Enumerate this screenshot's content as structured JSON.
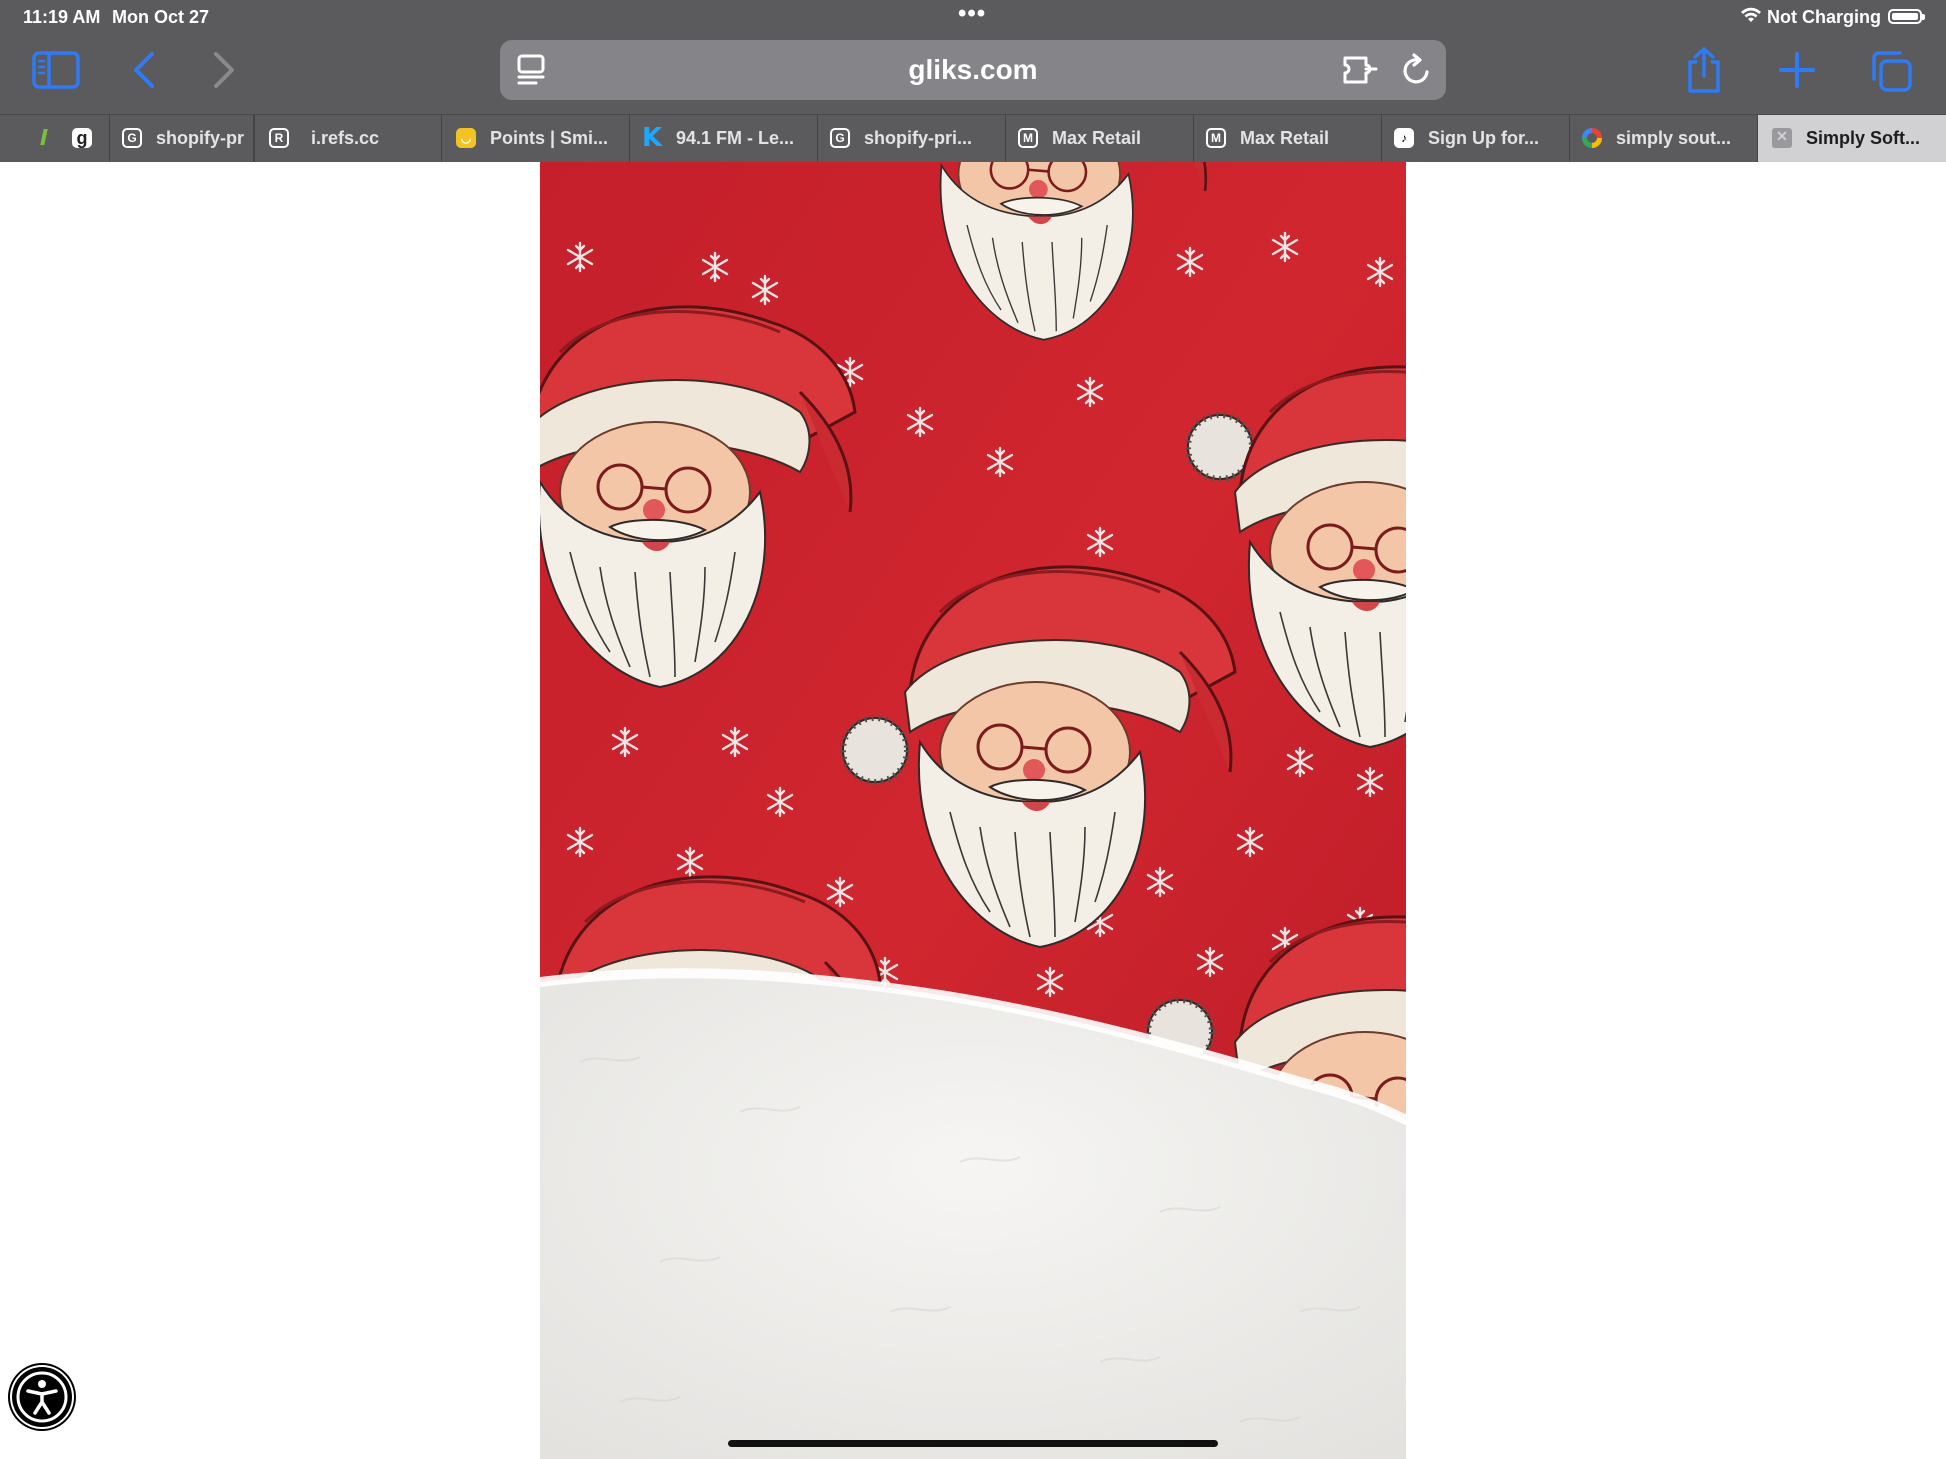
{
  "status_bar": {
    "time": "11:19 AM",
    "date": "Mon Oct 27",
    "dots": "•••",
    "battery_text": "Not Charging"
  },
  "toolbar": {
    "icons": [
      "sidebar-icon",
      "back-icon",
      "forward-icon",
      "share-icon",
      "plus-icon",
      "tabs-overview-icon"
    ]
  },
  "address_bar": {
    "url": "gliks.com",
    "icons": [
      "reader-icon",
      "extension-icon",
      "reload-icon"
    ]
  },
  "tabs": [
    {
      "label": "",
      "favicon": "g"
    },
    {
      "label": "shopify-pr",
      "favicon": "G"
    },
    {
      "label": "i.refs.cc",
      "favicon": "R"
    },
    {
      "label": "Points | Smi...",
      "favicon": "◡"
    },
    {
      "label": "94.1 FM - Le...",
      "favicon": "K"
    },
    {
      "label": "shopify-pri...",
      "favicon": "G"
    },
    {
      "label": "Max Retail",
      "favicon": "M"
    },
    {
      "label": "Max Retail",
      "favicon": "M"
    },
    {
      "label": "Sign Up for...",
      "favicon": "♪"
    },
    {
      "label": "simply sout...",
      "favicon": ""
    },
    {
      "label": "Simply Soft...",
      "favicon": "✕",
      "active": true
    }
  ],
  "colors": {
    "chrome": "#5b5b5e",
    "address_bar": "#858589",
    "accent_blue": "#2f7bf6",
    "blanket_red": "#c8232e",
    "sherpa_white": "#f1f0ee"
  }
}
